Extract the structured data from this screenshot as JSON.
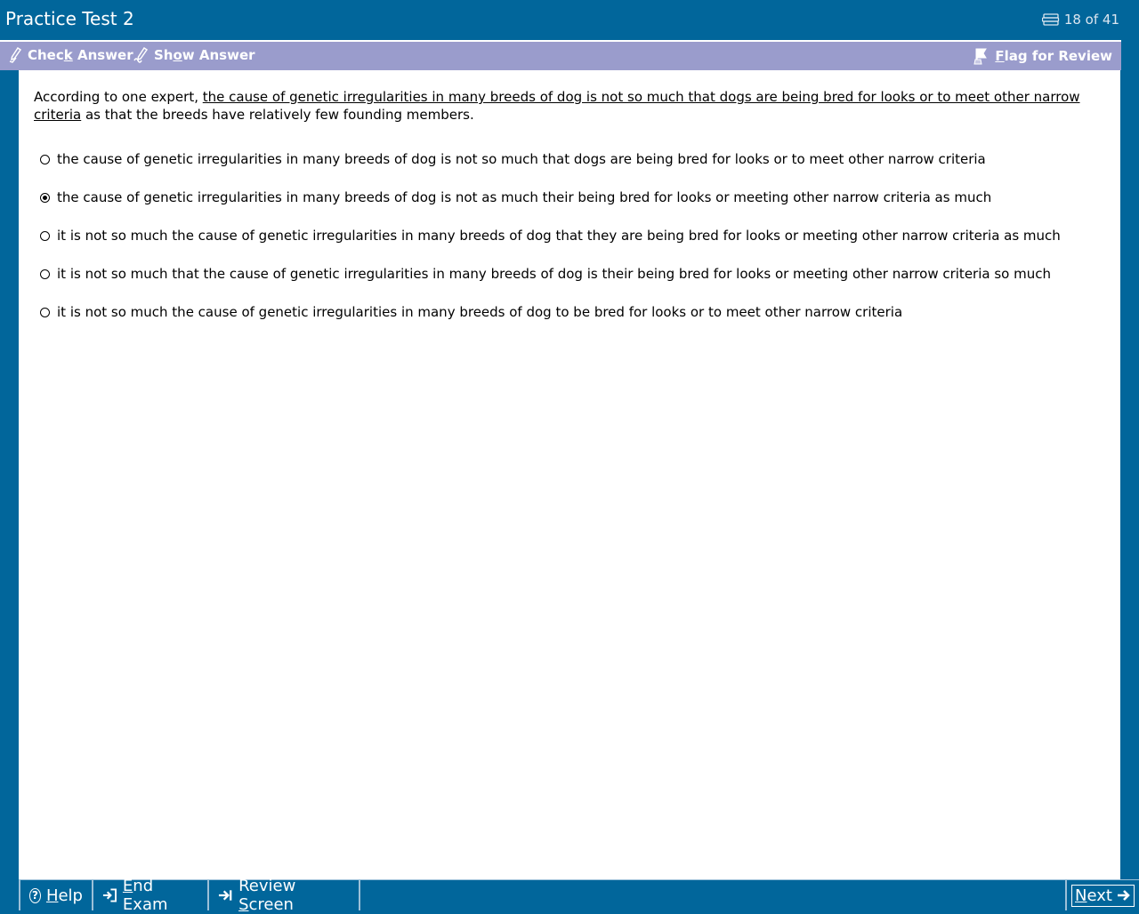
{
  "window": {
    "title": "Practice Test 2",
    "counter": "18 of 41"
  },
  "toolbar": {
    "check_answer": {
      "pre": "Chec",
      "key": "k",
      "post": " Answer"
    },
    "show_answer": {
      "pre": "Sh",
      "key": "o",
      "post": "w Answer"
    },
    "flag_review": {
      "pre": "",
      "key": "F",
      "post": "lag for Review"
    }
  },
  "question": {
    "stem_before": "According to one expert, ",
    "stem_underlined": "the cause of genetic irregularities in many breeds of dog is not so much that dogs are being bred for looks or to meet other narrow criteria",
    "stem_after": " as that the breeds have relatively few founding members.",
    "options": [
      {
        "text": "the cause of genetic irregularities in many breeds of dog is not so much that dogs are being bred for looks or to meet other narrow criteria",
        "selected": false
      },
      {
        "text": "the cause of genetic irregularities in many breeds of dog is not as much their being bred for looks or meeting other narrow criteria as much",
        "selected": true
      },
      {
        "text": "it is not so much the cause of genetic irregularities in many breeds of dog that they are being bred for looks or meeting other narrow criteria as much",
        "selected": false
      },
      {
        "text": "it is not so much that the cause of genetic irregularities in many breeds of dog is their being bred for looks or meeting other narrow criteria so much",
        "selected": false
      },
      {
        "text": "it is not so much the cause of genetic irregularities in many breeds of dog to be bred for looks or to meet other narrow criteria",
        "selected": false
      }
    ]
  },
  "bottom": {
    "help": {
      "key": "H",
      "post": "elp"
    },
    "end_exam": {
      "key": "E",
      "post": "nd Exam"
    },
    "review": {
      "pre": "Review ",
      "key": "S",
      "post": "creen"
    },
    "next": {
      "key": "N",
      "post": "ext"
    }
  },
  "colors": {
    "frame": "#01669b",
    "toolbar": "#9a9ccc",
    "content": "#ffffff"
  },
  "icons": {
    "counter": "tickets-icon",
    "check": "check-pencil-icon",
    "show": "show-pencil-icon",
    "flag": "flag-hand-icon",
    "help": "question-circle-icon",
    "end": "exit-arrow-icon",
    "review": "arrow-bar-icon",
    "next": "arrow-right-icon"
  }
}
